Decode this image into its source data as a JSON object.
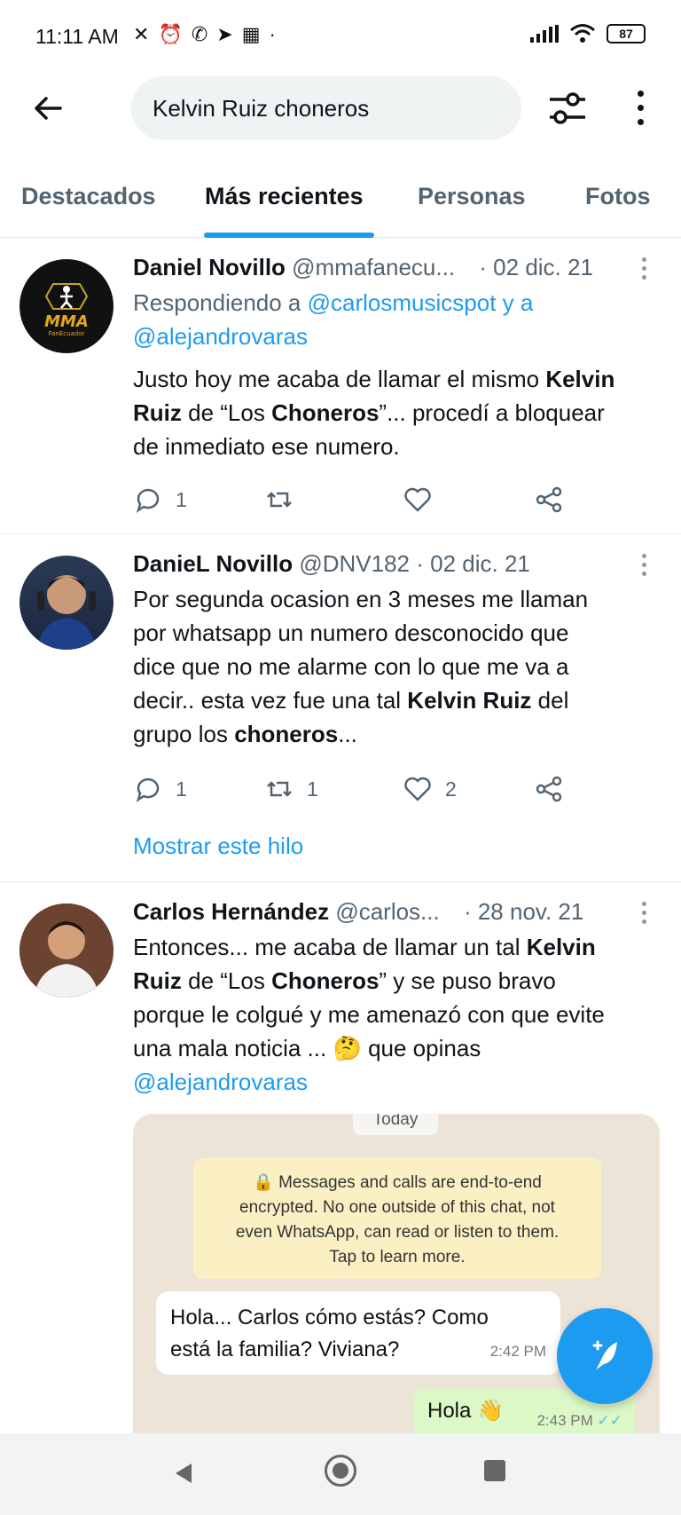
{
  "status_bar": {
    "time": "11:11 AM",
    "icons": [
      "silent-icon",
      "alarm-icon",
      "whatsapp-icon",
      "telegram-icon",
      "app-icon"
    ],
    "battery": "87"
  },
  "search": {
    "query": "Kelvin Ruiz choneros"
  },
  "tabs": [
    {
      "label": "Destacados",
      "active": false
    },
    {
      "label": "Más recientes",
      "active": true
    },
    {
      "label": "Personas",
      "active": false
    },
    {
      "label": "Fotos",
      "active": false
    }
  ],
  "tweets": [
    {
      "name": "Daniel Novillo",
      "handle": "@mmafanecu...",
      "date": "· 02 dic. 21",
      "reply_prefix": "Respondiendo a",
      "reply_to_1": "@carlosmusicspot y a",
      "reply_to_2": "@alejandrovaras",
      "line1_a": "Justo hoy me acaba de llamar el mismo ",
      "line1_b": "Kelvin",
      "line2_a": "Ruiz",
      "line2_b": " de “Los ",
      "line2_c": "Choneros",
      "line2_d": "”... procedí a bloquear",
      "line3": "de inmediato ese numero.",
      "replies": "1",
      "retweets": "",
      "likes": ""
    },
    {
      "name": "DanieL Novillo",
      "handle": "@DNV182",
      "date": "· 02 dic. 21",
      "line1": "Por segunda ocasion en 3 meses me llaman",
      "line2": "por whatsapp un numero desconocido que",
      "line3": "dice que no me alarme con lo que me va a",
      "line4_a": "decir.. esta vez fue una tal ",
      "line4_b": "Kelvin Ruiz",
      "line4_c": " del",
      "line5_a": "grupo los ",
      "line5_b": "choneros",
      "line5_c": "...",
      "replies": "1",
      "retweets": "1",
      "likes": "2",
      "show_thread": "Mostrar este hilo"
    },
    {
      "name": "Carlos Hernández",
      "handle": "@carlos...",
      "date": "· 28 nov. 21",
      "line1_a": "Entonces... me acaba de llamar un tal ",
      "line1_b": "Kelvin",
      "line2_a": "Ruiz",
      "line2_b": " de “Los ",
      "line2_c": "Choneros",
      "line2_d": "” y se puso bravo",
      "line3": "porque le colgué y me amenazó con que evite",
      "line4_a": "una mala noticia ... ",
      "line4_emoji": "🤔",
      "line4_b": " que opinas",
      "line5": "@alejandrovaras"
    }
  ],
  "chat_image": {
    "date_pill": "Today",
    "encryption_line1": "Messages and calls are end-to-end",
    "encryption_line2": "encrypted. No one outside of this chat, not",
    "encryption_line3": "even WhatsApp, can read or listen to them.",
    "encryption_line4": "Tap to learn more.",
    "incoming_line1": "Hola... Carlos cómo estás? Como",
    "incoming_line2": "está la familia? Viviana?",
    "incoming_time": "2:42 PM",
    "outgoing_text": "Hola 👋",
    "outgoing_time": "2:43 PM"
  },
  "fab": {
    "icon": "compose-tweet-icon"
  },
  "colors": {
    "accent": "#1d9bf0",
    "text": "#0f1419",
    "secondary": "#536471"
  }
}
